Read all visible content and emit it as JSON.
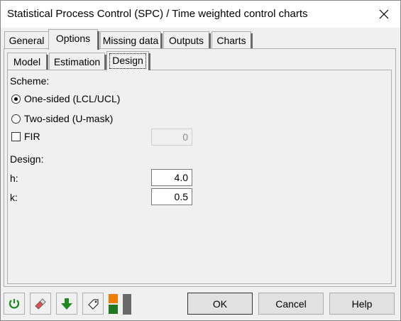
{
  "window": {
    "title": "Statistical Process Control (SPC) / Time weighted control charts"
  },
  "tabs": [
    {
      "label": "General"
    },
    {
      "label": "Options"
    },
    {
      "label": "Missing data"
    },
    {
      "label": "Outputs"
    },
    {
      "label": "Charts"
    }
  ],
  "active_tab": "Options",
  "sub_tabs": [
    {
      "label": "Model"
    },
    {
      "label": "Estimation"
    },
    {
      "label": "Design"
    }
  ],
  "active_sub_tab": "Design",
  "design": {
    "scheme_label": "Scheme:",
    "one_sided_label": "One-sided (LCL/UCL)",
    "two_sided_label": "Two-sided (U-mask)",
    "scheme_selected": "One-sided (LCL/UCL)",
    "fir_label": "FIR",
    "fir_checked": false,
    "fir_value": "0",
    "design_label": "Design:",
    "h_label": "h:",
    "h_value": "4.0",
    "k_label": "k:",
    "k_value": "0.5"
  },
  "buttons": {
    "ok": "OK",
    "cancel": "Cancel",
    "help": "Help"
  },
  "icons": [
    "reset-icon",
    "eraser-icon",
    "download-arrow-icon",
    "tag-icon",
    "color-squares-icon"
  ],
  "colors": {
    "accent_green": "#1a8c1a",
    "accent_orange": "#f07c00",
    "dark_green": "#1f7a1f"
  }
}
